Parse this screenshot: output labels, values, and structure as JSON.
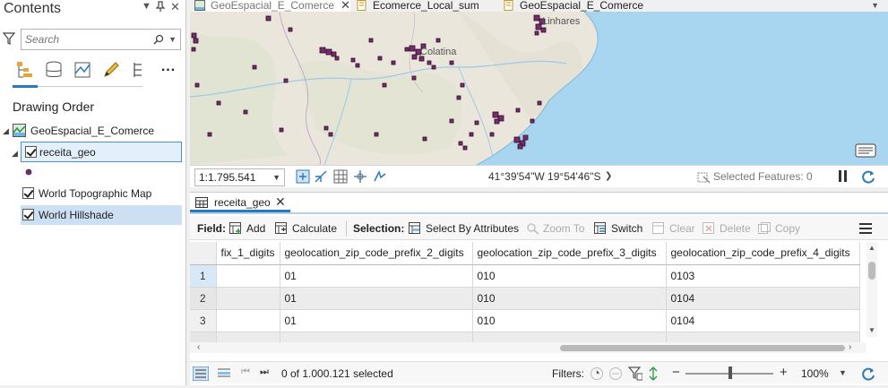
{
  "contents_pane": {
    "title": "Contents",
    "search_placeholder": "Search",
    "drawing_order_label": "Drawing Order",
    "map_name": "GeoEspacial_E_Comerce",
    "layers": [
      {
        "name": "receita_geo",
        "checked": true
      },
      {
        "name": "World Topographic Map",
        "checked": true
      },
      {
        "name": "World Hillshade",
        "checked": true
      }
    ],
    "more_label": "..."
  },
  "tabs": [
    {
      "label": "GeoEspacial_E_Comerce",
      "active": true,
      "closable": true
    },
    {
      "label": "Ecomerce_Local_sum",
      "active": false
    },
    {
      "label": "GeoEspacial_E_Comerce",
      "active": false
    }
  ],
  "map": {
    "place_labels": [
      "Colatina",
      "Linhares"
    ],
    "scale": "1:1.795.541",
    "coordinates": "41°39'54\"W 19°54'46\"S",
    "selected_features": "Selected Features: 0",
    "colors": {
      "water": "#a8d6f0",
      "land": "#eae6dc",
      "points": "#7a2a6e"
    }
  },
  "table": {
    "tab_label": "receita_geo",
    "field_label": "Field:",
    "add_label": "Add",
    "calculate_label": "Calculate",
    "selection_label": "Selection:",
    "select_by_attributes_label": "Select By Attributes",
    "zoom_to_label": "Zoom To",
    "switch_label": "Switch",
    "clear_label": "Clear",
    "delete_label": "Delete",
    "copy_label": "Copy",
    "columns": [
      "fix_1_digits",
      "geolocation_zip_code_prefix_2_digits",
      "geolocation_zip_code_prefix_3_digits",
      "geolocation_zip_code_prefix_4_digits"
    ],
    "rows": [
      {
        "num": "1",
        "cells": [
          "",
          "01",
          "010",
          "0103"
        ]
      },
      {
        "num": "2",
        "cells": [
          "",
          "01",
          "010",
          "0104"
        ]
      },
      {
        "num": "3",
        "cells": [
          "",
          "01",
          "010",
          "0104"
        ]
      }
    ],
    "selection_count": "0 of 1.000.121 selected",
    "filters_label": "Filters:",
    "zoom_percent": "100%"
  }
}
